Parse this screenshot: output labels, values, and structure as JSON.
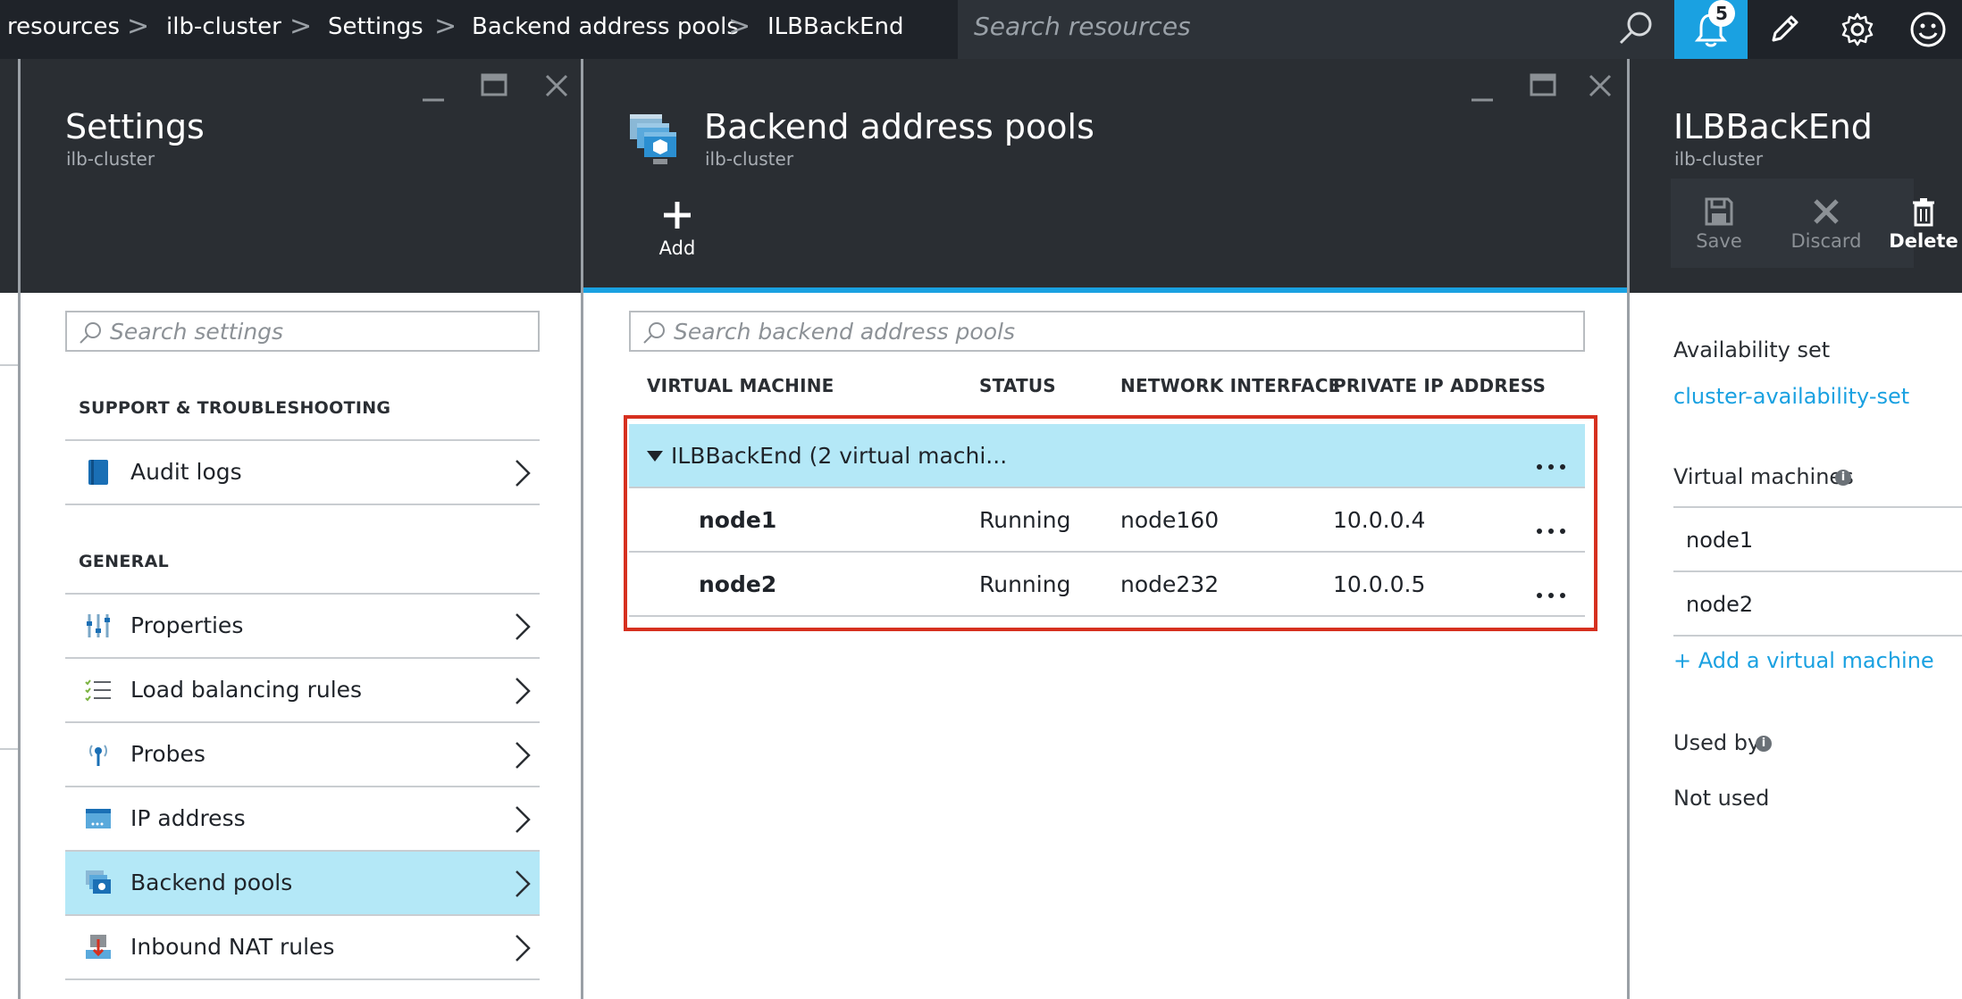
{
  "topbar": {
    "breadcrumbs": [
      "resources",
      "ilb-cluster",
      "Settings",
      "Backend address pools",
      "ILBBackEnd"
    ],
    "separator": ">",
    "search_placeholder": "Search resources",
    "notification_count": "5",
    "accent_color": "#1aa1e1"
  },
  "settings_blade": {
    "title": "Settings",
    "subtitle": "ilb-cluster",
    "search_placeholder": "Search settings",
    "sections": [
      {
        "label": "SUPPORT & TROUBLESHOOTING",
        "items": [
          {
            "label": "Audit logs",
            "icon": "audit-logs-icon"
          }
        ]
      },
      {
        "label": "GENERAL",
        "items": [
          {
            "label": "Properties",
            "icon": "properties-icon"
          },
          {
            "label": "Load balancing rules",
            "icon": "load-balancing-rules-icon"
          },
          {
            "label": "Probes",
            "icon": "probes-icon"
          },
          {
            "label": "IP address",
            "icon": "ip-address-icon"
          },
          {
            "label": "Backend pools",
            "icon": "backend-pools-icon",
            "selected": true
          },
          {
            "label": "Inbound NAT rules",
            "icon": "inbound-nat-rules-icon"
          }
        ]
      }
    ]
  },
  "pools_blade": {
    "title": "Backend address pools",
    "subtitle": "ilb-cluster",
    "add_label": "Add",
    "search_placeholder": "Search backend address pools",
    "columns": [
      "VIRTUAL MACHINE",
      "STATUS",
      "NETWORK INTERFACE",
      "PRIVATE IP ADDRESS"
    ],
    "group_label": "ILBBackEnd (2 virtual machi...",
    "rows": [
      {
        "vm": "node1",
        "status": "Running",
        "nic": "node160",
        "ip": "10.0.0.4"
      },
      {
        "vm": "node2",
        "status": "Running",
        "nic": "node232",
        "ip": "10.0.0.5"
      }
    ],
    "highlight_color": "#d6301f"
  },
  "detail_blade": {
    "title": "ILBBackEnd",
    "subtitle": "ilb-cluster",
    "toolbar": {
      "save": "Save",
      "discard": "Discard",
      "delete": "Delete"
    },
    "availability_set_label": "Availability set",
    "availability_set_value": "cluster-availability-set",
    "vms_label": "Virtual machines",
    "vms": [
      "node1",
      "node2"
    ],
    "add_vm_link": "+ Add a virtual machine",
    "used_by_label": "Used by",
    "used_by_value": "Not used"
  }
}
